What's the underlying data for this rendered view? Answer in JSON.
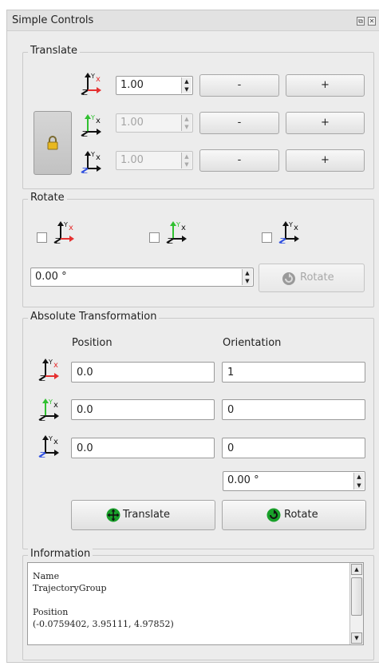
{
  "window": {
    "title": "Simple Controls",
    "float_icon": "float-icon",
    "close_icon": "close-icon"
  },
  "translate": {
    "title": "Translate",
    "rows": [
      {
        "axis": "x",
        "color": "#e53030",
        "value": "1.00",
        "enabled": true
      },
      {
        "axis": "y",
        "color": "#30c030",
        "value": "1.00",
        "enabled": false
      },
      {
        "axis": "z",
        "color": "#3050e0",
        "value": "1.00",
        "enabled": false
      }
    ],
    "minus_label": "-",
    "plus_label": "+",
    "lock_icon": "lock-icon"
  },
  "rotate": {
    "title": "Rotate",
    "angle": "0.00 °",
    "button_label": "Rotate"
  },
  "absolute": {
    "title": "Absolute Transformation",
    "position_header": "Position",
    "orientation_header": "Orientation",
    "position": [
      "0.0",
      "0.0",
      "0.0"
    ],
    "orientation": [
      "1",
      "0",
      "0"
    ],
    "angle": "0.00 °",
    "translate_label": "Translate",
    "rotate_label": "Rotate"
  },
  "information": {
    "title": "Information",
    "lines": [
      "Name",
      "TrajectoryGroup",
      "",
      "Position",
      "(-0.0759402, 3.95111, 4.97852)"
    ]
  },
  "colors": {
    "x": "#e53030",
    "y": "#30c030",
    "z": "#3050e0",
    "axis": "#111111"
  }
}
